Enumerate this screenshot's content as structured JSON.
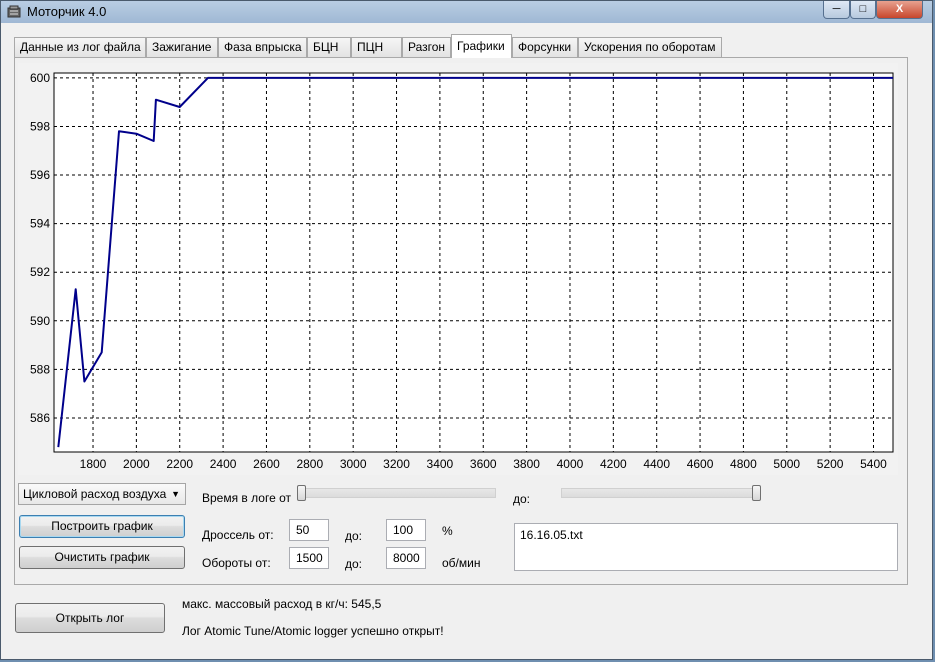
{
  "window": {
    "title": "Моторчик 4.0",
    "min_glyph": "─",
    "max_glyph": "□",
    "close_glyph": "X"
  },
  "tabs": [
    {
      "label": "Данные из лог файла",
      "active": false
    },
    {
      "label": "Зажигание",
      "active": false
    },
    {
      "label": "Фаза впрыска",
      "active": false
    },
    {
      "label": "БЦН",
      "active": false
    },
    {
      "label": "ПЦН",
      "active": false
    },
    {
      "label": "Разгон",
      "active": false
    },
    {
      "label": "Графики",
      "active": true
    },
    {
      "label": "Форсунки",
      "active": false
    },
    {
      "label": "Ускорения по оборотам",
      "active": false
    }
  ],
  "chart_data": {
    "type": "line",
    "xlim": [
      1620,
      5490
    ],
    "ylim": [
      584.6,
      600.2
    ],
    "x_ticks": [
      1800,
      2000,
      2200,
      2400,
      2600,
      2800,
      3000,
      3200,
      3400,
      3600,
      3800,
      4000,
      4200,
      4400,
      4600,
      4800,
      5000,
      5200,
      5400
    ],
    "y_ticks": [
      586,
      588,
      590,
      592,
      594,
      596,
      598,
      600
    ],
    "grid": true,
    "color": "#00008b",
    "series": [
      {
        "x": [
          1640,
          1720,
          1760,
          1840,
          1920,
          2000,
          2080,
          2090,
          2200,
          2330,
          5490
        ],
        "y": [
          584.8,
          591.3,
          587.5,
          588.7,
          597.8,
          597.7,
          597.4,
          599.1,
          598.8,
          600,
          600
        ]
      }
    ]
  },
  "controls": {
    "combo_value": "Цикловой расход воздуха",
    "build_button": "Построить график",
    "clear_button": "Очистить график",
    "time_from_label": "Время в логе от",
    "time_to_label": "до:",
    "time_from_value": 0,
    "time_to_value": 1,
    "throttle_label": "Дроссель от:",
    "throttle_from": "50",
    "throttle_to_label": "до:",
    "throttle_to": "100",
    "throttle_unit": "%",
    "rpm_label": "Обороты от:",
    "rpm_from": "1500",
    "rpm_to_label": "до:",
    "rpm_to": "8000",
    "rpm_unit": "об/мин",
    "file_list": "16.16.05.txt"
  },
  "bottom": {
    "open_log_button": "Открыть лог",
    "max_flow_text": "макс. массовый расход в кг/ч: 545,5",
    "status_text": "Лог Atomic Tune/Atomic logger успешно открыт!"
  }
}
